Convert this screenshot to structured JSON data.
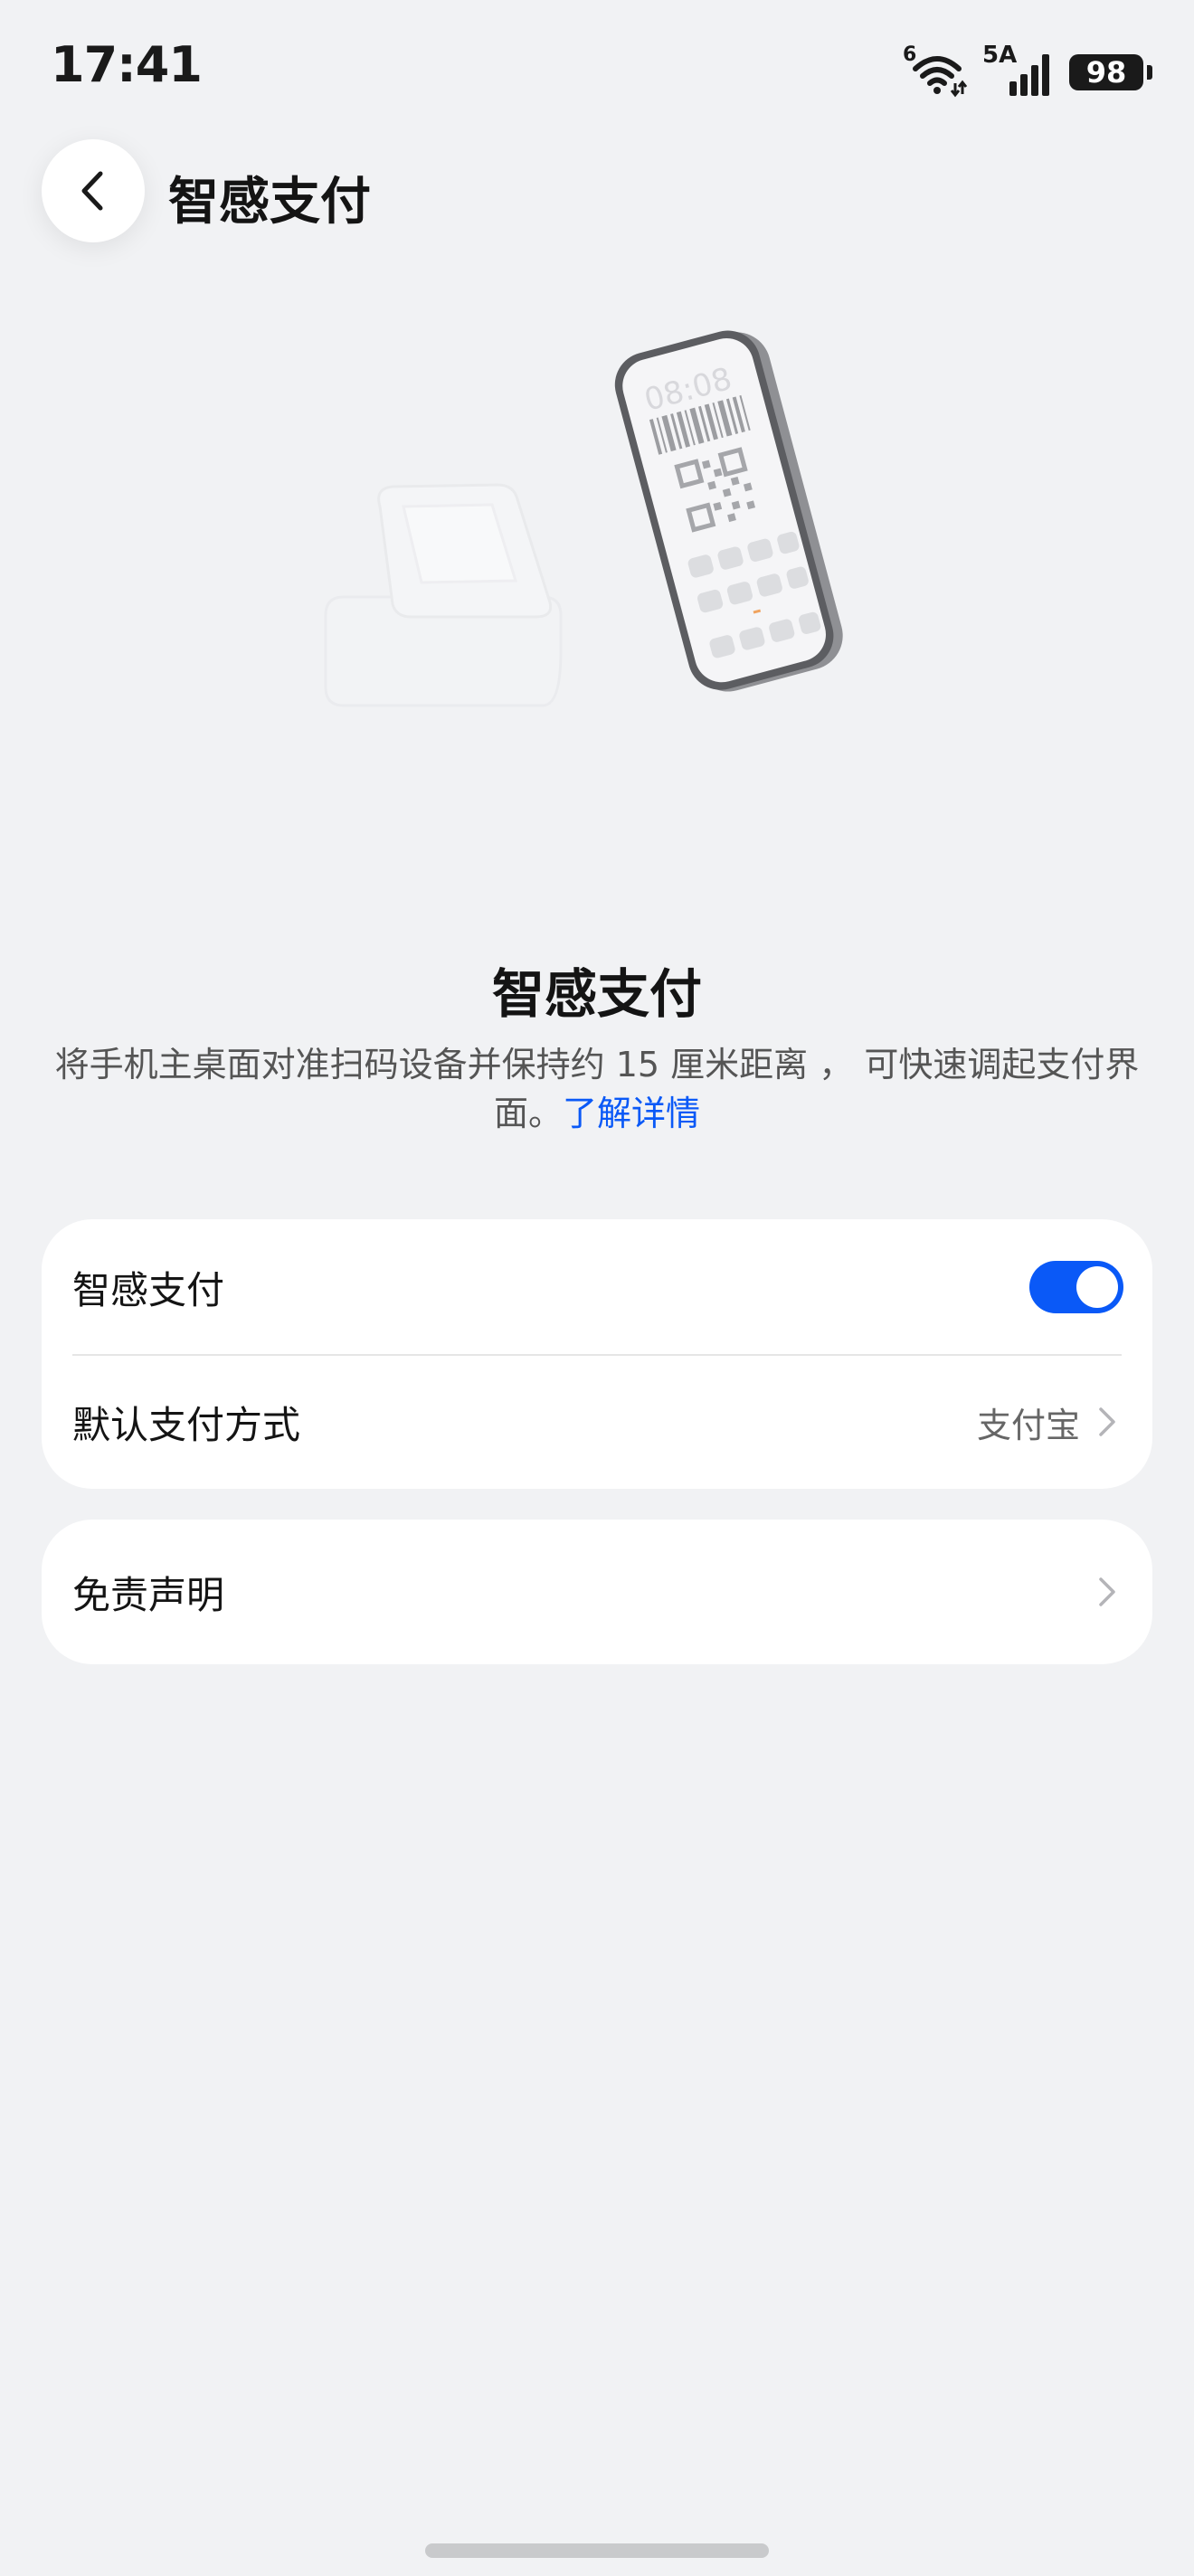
{
  "status_bar": {
    "time": "17:41",
    "wifi_label": "6",
    "cellular_label": "5A",
    "battery": "98"
  },
  "header": {
    "title": "智感支付"
  },
  "intro": {
    "title": "智感支付",
    "description": "将手机主桌面对准扫码设备并保持约 15 厘米距离 ， 可快速调起支付界面。",
    "learn_more": "了解详情"
  },
  "settings": {
    "smart_pay": {
      "label": "智感支付",
      "enabled": true
    },
    "default_method": {
      "label": "默认支付方式",
      "value": "支付宝"
    },
    "disclaimer": {
      "label": "免责声明"
    }
  },
  "colors": {
    "accent": "#0a59f7",
    "background": "#f1f2f4",
    "card": "#ffffff"
  }
}
